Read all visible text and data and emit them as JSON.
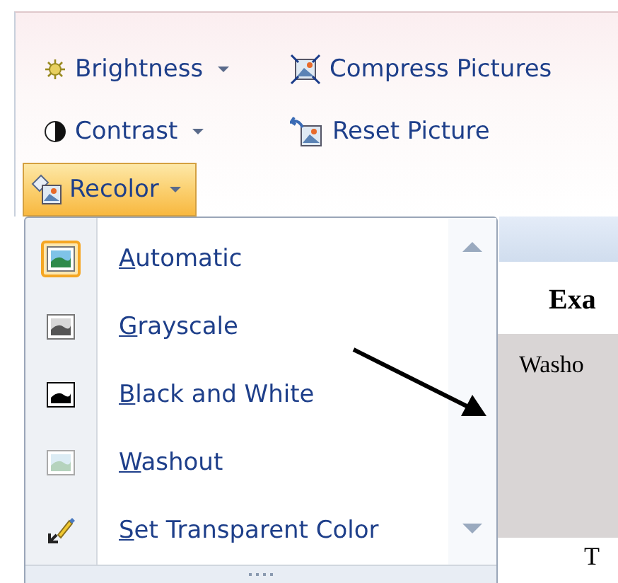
{
  "toolbar": {
    "rows": [
      [
        {
          "label": "Brightness",
          "dropdown": true
        },
        {
          "label": "Compress Pictures",
          "dropdown": false
        }
      ],
      [
        {
          "label": "Contrast",
          "dropdown": true
        },
        {
          "label": "Reset Picture",
          "dropdown": false
        }
      ]
    ]
  },
  "recolor_button": {
    "label": "Recolor",
    "pressed": true,
    "dropdown": true
  },
  "recolor_menu": {
    "items": [
      {
        "label": "Automatic",
        "selected": true
      },
      {
        "label": "Grayscale",
        "selected": false
      },
      {
        "label": "Black and White",
        "selected": false
      },
      {
        "label": "Washout",
        "selected": false
      },
      {
        "label": "Set Transparent Color",
        "selected": false
      }
    ]
  },
  "document": {
    "heading": "Exa",
    "callout": "Washo",
    "text": "T"
  }
}
